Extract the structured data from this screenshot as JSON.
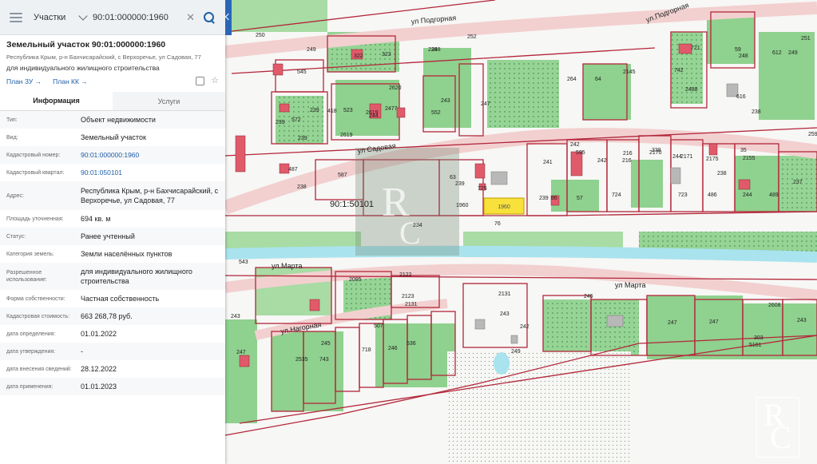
{
  "search": {
    "category": "Участки",
    "query": "90:01:000000:1960"
  },
  "card": {
    "title": "Земельный участок 90:01:000000:1960",
    "address_short": "Республика Крым, р-н Бахчисарайский, с Верхоречье, ул Садовая, 77",
    "purpose": "для индивидуального жилищного строительства",
    "plan_zu": "План ЗУ →",
    "plan_kk": "План КК →"
  },
  "tabs": [
    "Информация",
    "Услуги"
  ],
  "info_rows": [
    {
      "label": "Тип:",
      "value": "Объект недвижимости"
    },
    {
      "label": "Вид:",
      "value": "Земельный участок"
    },
    {
      "label": "Кадастровый номер:",
      "value": "90:01:000000:1960",
      "link": true
    },
    {
      "label": "Кадастровый квартал:",
      "value": "90:01:050101",
      "link": true
    },
    {
      "label": "Адрес:",
      "value": "Республика Крым, р-н Бахчисарайский, с Верхоречье, ул Садовая, 77"
    },
    {
      "label": "Площадь уточненная:",
      "value": "694 кв. м"
    },
    {
      "label": "Статус:",
      "value": "Ранее учтенный"
    },
    {
      "label": "Категория земель:",
      "value": "Земли населённых пунктов"
    },
    {
      "label": "Разрешенное использование:",
      "value": "для индивидуального жилищного строительства"
    },
    {
      "label": "Форма собственности:",
      "value": "Частная собственность"
    },
    {
      "label": "Кадастровая стоимость:",
      "value": "663 268,78 руб."
    },
    {
      "label": "дата определения:",
      "value": "01.01.2022"
    },
    {
      "label": "дата утверждения:",
      "value": "-"
    },
    {
      "label": "дата внесения сведений:",
      "value": "28.12.2022"
    },
    {
      "label": "дата применения:",
      "value": "01.01.2023"
    }
  ],
  "map": {
    "streets": [
      "ул Подгорная",
      "ул.Подгорная",
      "ул Садовая",
      "ул.Марта",
      "ул Марта",
      "ул.Нагорная"
    ],
    "quarter_label": "90:1:50101",
    "selected_parcel": "1960",
    "parcel_numbers": [
      "250",
      "249",
      "545",
      "322",
      "323",
      "248",
      "252",
      "238",
      "264",
      "64",
      "2145",
      "2488",
      "721",
      "59",
      "248",
      "616",
      "612",
      "249",
      "251",
      "239",
      "572",
      "239",
      "418",
      "523",
      "2620",
      "2477",
      "2619",
      "552",
      "243",
      "247",
      "742",
      "238",
      "239",
      "2619",
      "244",
      "2591",
      "595",
      "216",
      "338",
      "244",
      "35",
      "2155",
      "487",
      "587",
      "63",
      "241",
      "242",
      "242",
      "216",
      "2170",
      "2171",
      "2175",
      "238",
      "239",
      "725",
      "1960",
      "76",
      "239",
      "86",
      "57",
      "724",
      "723",
      "486",
      "244",
      "489",
      "237",
      "238",
      "234",
      "543",
      "2095",
      "2122",
      "2123",
      "2131",
      "2131",
      "243",
      "242",
      "246",
      "247",
      "2608",
      "243",
      "247",
      "247",
      "5161",
      "245",
      "507",
      "718",
      "246",
      "536",
      "2535",
      "743",
      "249",
      "303",
      "243"
    ],
    "colors": {
      "vegetation": "#8fd18e",
      "parcel_border": "#b3263a",
      "road": "#f2d0d0",
      "river": "#a9e3ee",
      "selected": "#f7e13a",
      "building": "#e05a6a"
    }
  },
  "watermark": {
    "letters": [
      "R",
      "C"
    ]
  }
}
